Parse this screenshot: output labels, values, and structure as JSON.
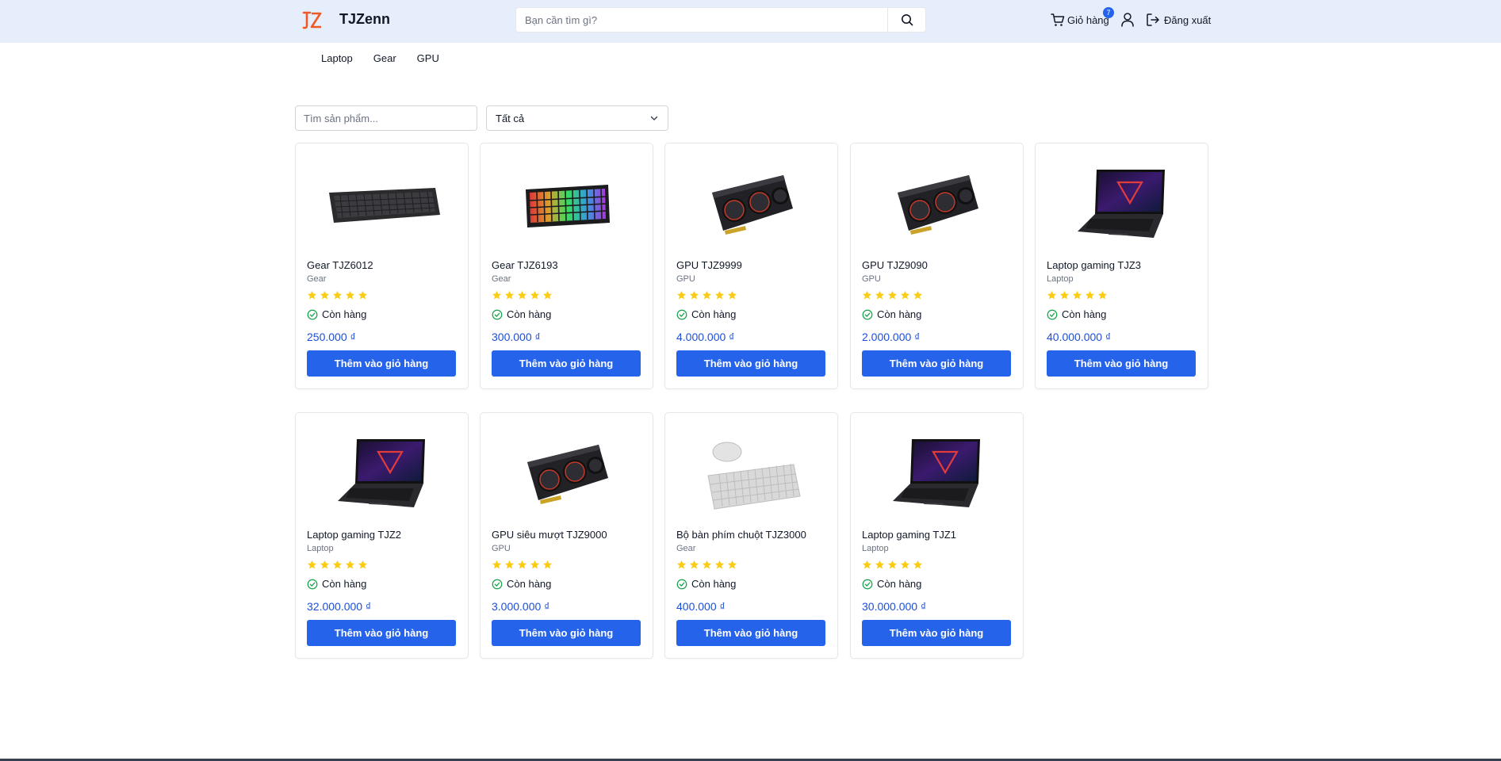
{
  "header": {
    "logo_text": "TJZenn",
    "search": {
      "placeholder": "Bạn cần tìm gì?"
    },
    "cart": {
      "label": "Giỏ hàng",
      "count": "7"
    },
    "logout_label": "Đăng xuất",
    "background_color": "#e6eefc"
  },
  "nav": {
    "items": [
      "Laptop",
      "Gear",
      "GPU"
    ]
  },
  "filters": {
    "search_placeholder": "Tìm sản phẩm...",
    "category_selected": "Tất cả"
  },
  "accent_color": "#2563eb",
  "products": [
    {
      "name": "Gear TJZ6012",
      "category": "Gear",
      "rating": 5,
      "stock": "Còn hàng",
      "price": "250.000 ₫",
      "button": "Thêm vào giỏ hàng",
      "image": "keyboard-icon"
    },
    {
      "name": "Gear TJZ6193",
      "category": "Gear",
      "rating": 5,
      "stock": "Còn hàng",
      "price": "300.000 ₫",
      "button": "Thêm vào giỏ hàng",
      "image": "rgb-keyboard-icon"
    },
    {
      "name": "GPU TJZ9999",
      "category": "GPU",
      "rating": 5,
      "stock": "Còn hàng",
      "price": "4.000.000 ₫",
      "button": "Thêm vào giỏ hàng",
      "image": "gpu-icon"
    },
    {
      "name": "GPU TJZ9090",
      "category": "GPU",
      "rating": 5,
      "stock": "Còn hàng",
      "price": "2.000.000 ₫",
      "button": "Thêm vào giỏ hàng",
      "image": "gpu-icon"
    },
    {
      "name": "Laptop gaming TJZ3",
      "category": "Laptop",
      "rating": 5,
      "stock": "Còn hàng",
      "price": "40.000.000 ₫",
      "button": "Thêm vào giỏ hàng",
      "image": "laptop-icon"
    },
    {
      "name": "Laptop gaming TJZ2",
      "category": "Laptop",
      "rating": 5,
      "stock": "Còn hàng",
      "price": "32.000.000 ₫",
      "button": "Thêm vào giỏ hàng",
      "image": "laptop-icon"
    },
    {
      "name": "GPU siêu mượt TJZ9000",
      "category": "GPU",
      "rating": 5,
      "stock": "Còn hàng",
      "price": "3.000.000 ₫",
      "button": "Thêm vào giỏ hàng",
      "image": "gpu-icon"
    },
    {
      "name": "Bộ bàn phím chuột TJZ3000",
      "category": "Gear",
      "rating": 5,
      "stock": "Còn hàng",
      "price": "400.000 ₫",
      "button": "Thêm vào giỏ hàng",
      "image": "keyboard-mouse-icon"
    },
    {
      "name": "Laptop gaming TJZ1",
      "category": "Laptop",
      "rating": 5,
      "stock": "Còn hàng",
      "price": "30.000.000 ₫",
      "button": "Thêm vào giỏ hàng",
      "image": "laptop-icon"
    }
  ]
}
